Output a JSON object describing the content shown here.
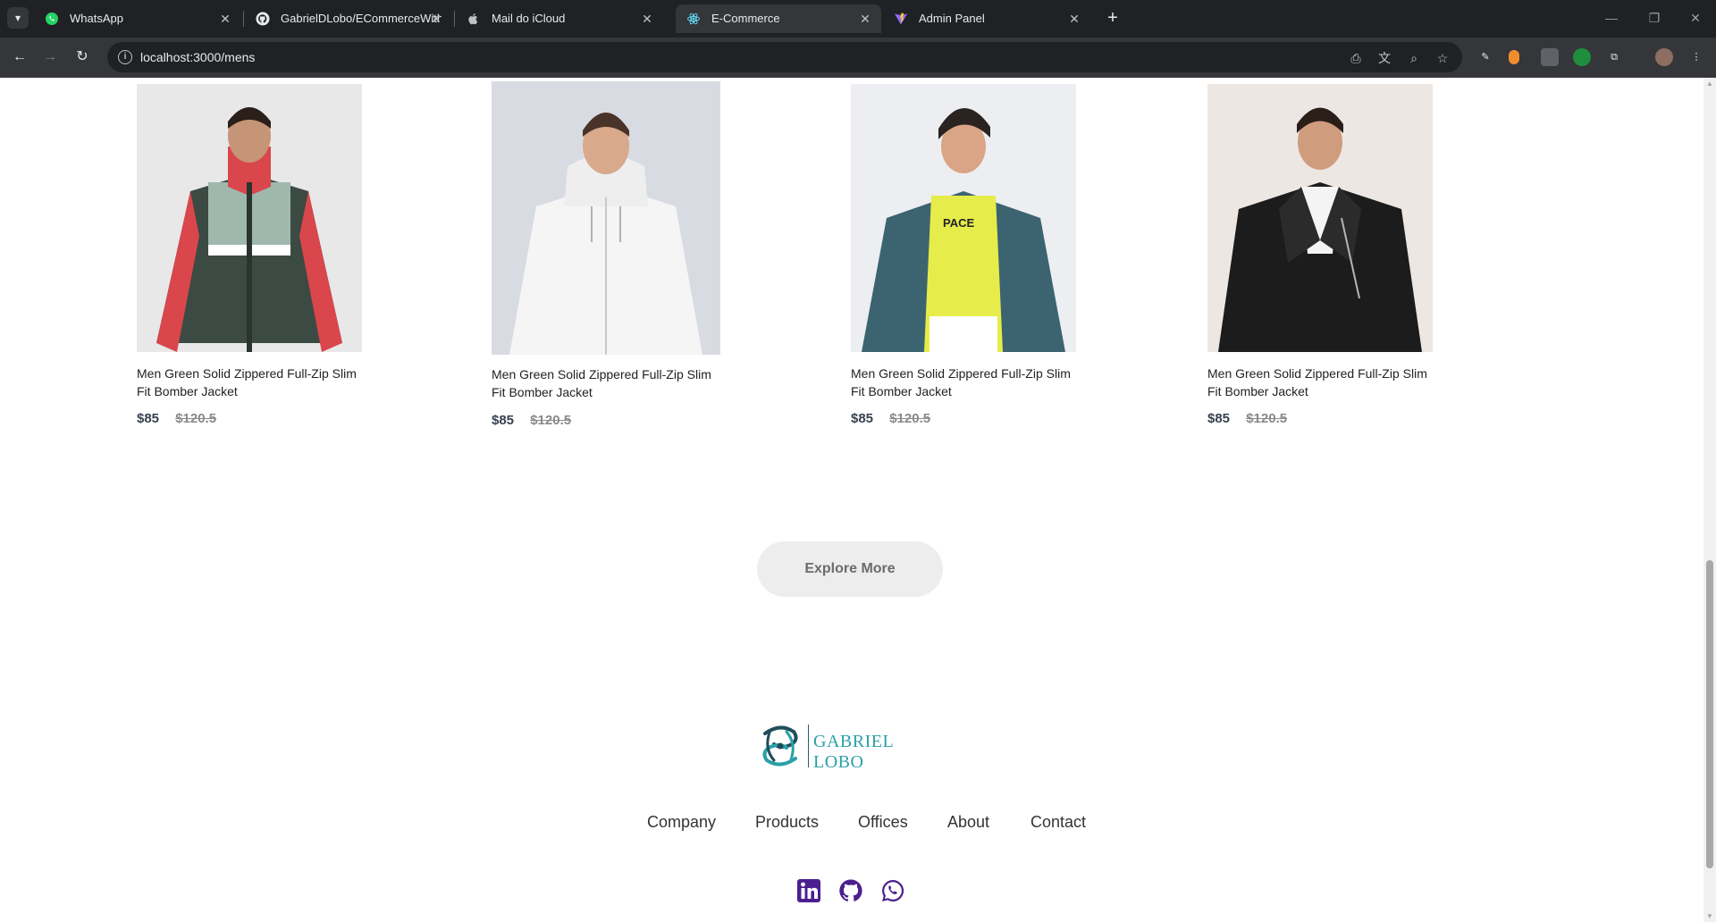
{
  "browser": {
    "tabs": [
      {
        "title": "WhatsApp",
        "icon": "whatsapp-icon",
        "active": false
      },
      {
        "title": "GabrielDLobo/ECommerceWith",
        "icon": "github-icon",
        "active": false
      },
      {
        "title": "Mail do iCloud",
        "icon": "apple-icon",
        "active": false
      },
      {
        "title": "E-Commerce",
        "icon": "react-icon",
        "active": true
      },
      {
        "title": "Admin Panel",
        "icon": "vite-icon",
        "active": false
      }
    ],
    "url": "localhost:3000/mens"
  },
  "products": [
    {
      "name": "Men Green Solid Zippered Full-Zip Slim Fit Bomber Jacket",
      "new_price": "$85",
      "old_price": "$120.5",
      "image": "red-green-jacket"
    },
    {
      "name": "Men Green Solid Zippered Full-Zip Slim Fit Bomber Jacket",
      "new_price": "$85",
      "old_price": "$120.5",
      "image": "white-hooded-jacket"
    },
    {
      "name": "Men Green Solid Zippered Full-Zip Slim Fit Bomber Jacket",
      "new_price": "$85",
      "old_price": "$120.5",
      "image": "denim-jacket-yellow-hoodie"
    },
    {
      "name": "Men Green Solid Zippered Full-Zip Slim Fit Bomber Jacket",
      "new_price": "$85",
      "old_price": "$120.5",
      "image": "black-leather-jacket"
    }
  ],
  "explore_label": "Explore More",
  "footer": {
    "logo_text": "GABRIEL LOBO",
    "links": [
      "Company",
      "Products",
      "Offices",
      "About",
      "Contact"
    ],
    "social": [
      "linkedin-icon",
      "github-icon",
      "whatsapp-icon"
    ],
    "social_color": "#4b1f8f"
  }
}
